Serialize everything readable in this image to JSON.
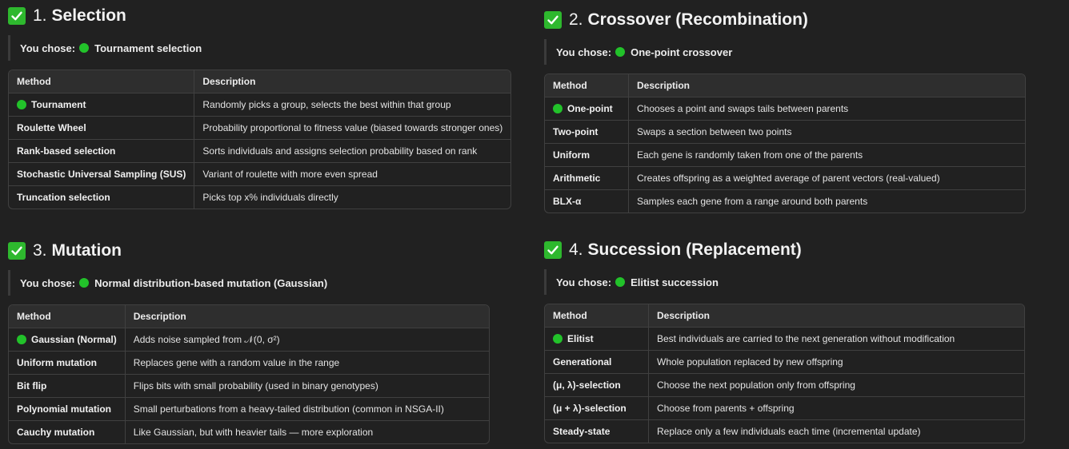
{
  "sections": [
    {
      "number": "1.",
      "title": "Selection",
      "chose_prefix": "You chose:",
      "chose_value": "Tournament selection",
      "headers": [
        "Method",
        "Description"
      ],
      "rows": [
        {
          "method": "Tournament",
          "description": "Randomly picks a group, selects the best within that group",
          "selected": true
        },
        {
          "method": "Roulette Wheel",
          "description": "Probability proportional to fitness value (biased towards stronger ones)"
        },
        {
          "method": "Rank-based selection",
          "description": "Sorts individuals and assigns selection probability based on rank"
        },
        {
          "method": "Stochastic Universal Sampling (SUS)",
          "description": "Variant of roulette with more even spread"
        },
        {
          "method": "Truncation selection",
          "description": "Picks top x% individuals directly"
        }
      ]
    },
    {
      "number": "2.",
      "title": "Crossover (Recombination)",
      "chose_prefix": "You chose:",
      "chose_value": "One-point crossover",
      "headers": [
        "Method",
        "Description"
      ],
      "rows": [
        {
          "method": "One-point",
          "description": "Chooses a point and swaps tails between parents",
          "selected": true
        },
        {
          "method": "Two-point",
          "description": "Swaps a section between two points"
        },
        {
          "method": "Uniform",
          "description": "Each gene is randomly taken from one of the parents"
        },
        {
          "method": "Arithmetic",
          "description": "Creates offspring as a weighted average of parent vectors (real-valued)"
        },
        {
          "method": "BLX-α",
          "description": "Samples each gene from a range around both parents"
        }
      ]
    },
    {
      "number": "3.",
      "title": "Mutation",
      "chose_prefix": "You chose:",
      "chose_value": "Normal distribution-based mutation (Gaussian)",
      "headers": [
        "Method",
        "Description"
      ],
      "rows": [
        {
          "method": "Gaussian (Normal)",
          "description": "Adds noise sampled from 𝒩(0, σ²)",
          "selected": true
        },
        {
          "method": "Uniform mutation",
          "description": "Replaces gene with a random value in the range"
        },
        {
          "method": "Bit flip",
          "description": "Flips bits with small probability (used in binary genotypes)"
        },
        {
          "method": "Polynomial mutation",
          "description": "Small perturbations from a heavy-tailed distribution (common in NSGA-II)"
        },
        {
          "method": "Cauchy mutation",
          "description": "Like Gaussian, but with heavier tails — more exploration"
        }
      ]
    },
    {
      "number": "4.",
      "title": "Succession (Replacement)",
      "chose_prefix": "You chose:",
      "chose_value": "Elitist succession",
      "headers": [
        "Method",
        "Description"
      ],
      "rows": [
        {
          "method": "Elitist",
          "description": "Best individuals are carried to the next generation without modification",
          "selected": true
        },
        {
          "method": "Generational",
          "description": "Whole population replaced by new offspring"
        },
        {
          "method": "(μ, λ)-selection",
          "description": "Choose the next population only from offspring"
        },
        {
          "method": "(μ + λ)-selection",
          "description": "Choose from parents + offspring"
        },
        {
          "method": "Steady-state",
          "description": "Replace only a few individuals each time (incremental update)"
        }
      ]
    }
  ]
}
